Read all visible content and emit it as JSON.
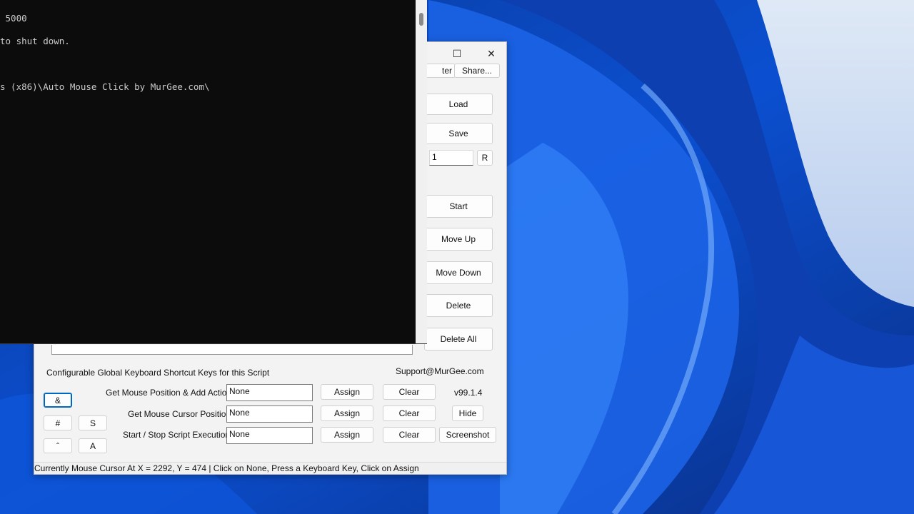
{
  "app": {
    "toolbar": {
      "filter_partial": "ter",
      "share_label": "Share..."
    },
    "side_buttons": {
      "load": "Load",
      "save": "Save",
      "repeat_value": "1",
      "reset_label": "R",
      "start": "Start",
      "move_up": "Move Up",
      "move_down": "Move Down",
      "delete": "Delete",
      "delete_all": "Delete All"
    },
    "shortcuts": {
      "heading": "Configurable Global Keyboard Shortcut Keys for this Script",
      "support_email": "Support@MurGee.com",
      "version": "v99.1.4",
      "rows": [
        {
          "label": "Get Mouse Position & Add Action :",
          "value": "None",
          "assign": "Assign",
          "clear": "Clear",
          "extra": ""
        },
        {
          "label": "Get Mouse Cursor Position :",
          "value": "None",
          "assign": "Assign",
          "clear": "Clear",
          "extra": "Hide"
        },
        {
          "label": "Start / Stop Script Execution :",
          "value": "None",
          "assign": "Assign",
          "clear": "Clear",
          "extra": "Screenshot"
        }
      ],
      "key_buttons": {
        "amp": "&",
        "hash": "#",
        "s": "S",
        "caret": "ˆ",
        "a": "A"
      }
    },
    "status": "Currently Mouse Cursor At X = 2292, Y = 474 | Click on None, Press a Keyboard Key, Click on Assign"
  },
  "console": {
    "lines": [
      " 5000",
      "to shut down.",
      "",
      "s (x86)\\Auto Mouse Click by MurGee.com\\"
    ]
  },
  "colors": {
    "console_bg": "#0c0c0c",
    "console_text": "#cccccc",
    "window_bg": "#f3f3f3",
    "accent": "#0067c0"
  }
}
